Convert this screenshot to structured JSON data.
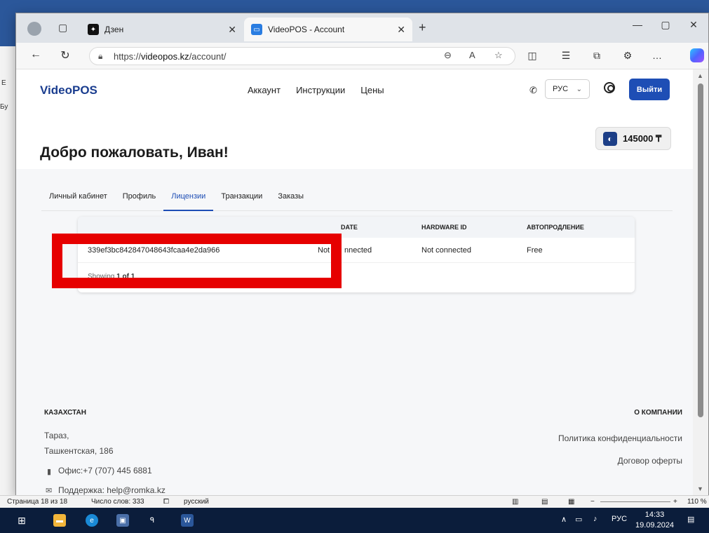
{
  "word_bg": {
    "side_letters": [
      "Бу",
      "Е"
    ],
    "status": {
      "page": "Страница 18 из 18",
      "words": "Число слов: 333",
      "language": "русский",
      "zoom": "110 %"
    }
  },
  "browser": {
    "tabs": [
      {
        "title": "Дзен",
        "icon": "dzen-icon"
      },
      {
        "title": "VideoPOS - Account",
        "icon": "videopos-icon",
        "active": true
      }
    ],
    "url": {
      "prefix": "https://",
      "host": "videopos.kz",
      "path": "/account/"
    }
  },
  "site": {
    "logo": "VideoPOS",
    "nav": [
      "Аккаунт",
      "Инструкции",
      "Цены"
    ],
    "language": "РУС",
    "logout": "Выйти",
    "welcome": "Добро пожаловать, Иван!",
    "balance": "145000 ₸",
    "tabs": [
      "Личный кабинет",
      "Профиль",
      "Лицензии",
      "Транзакции",
      "Заказы"
    ],
    "active_tab": "Лицензии",
    "table": {
      "headers": [
        "DATE",
        "HARDWARE ID",
        "АВТОПРОДЛЕНИЕ"
      ],
      "row": {
        "key": "339ef3bc842847048643fcaa4e2da966",
        "date_visible": "Not",
        "date_visible_2": "nnected",
        "hardware": "Not connected",
        "renewal": "Free"
      },
      "footer_prefix": "Showing",
      "footer_value": "1 of 1"
    },
    "footer": {
      "left_title": "КАЗАХСТАН",
      "city": "Тараз,",
      "street": "Ташкентская, 186",
      "office": "Офис:+7 (707) 445 6881",
      "support": "Поддержка: help@romka.kz",
      "right_title": "О КОМПАНИИ",
      "privacy": "Политика конфиденциальности",
      "offer": "Договор оферты"
    }
  },
  "taskbar": {
    "lang": "РУС",
    "time": "14:33",
    "date": "19.09.2024"
  }
}
